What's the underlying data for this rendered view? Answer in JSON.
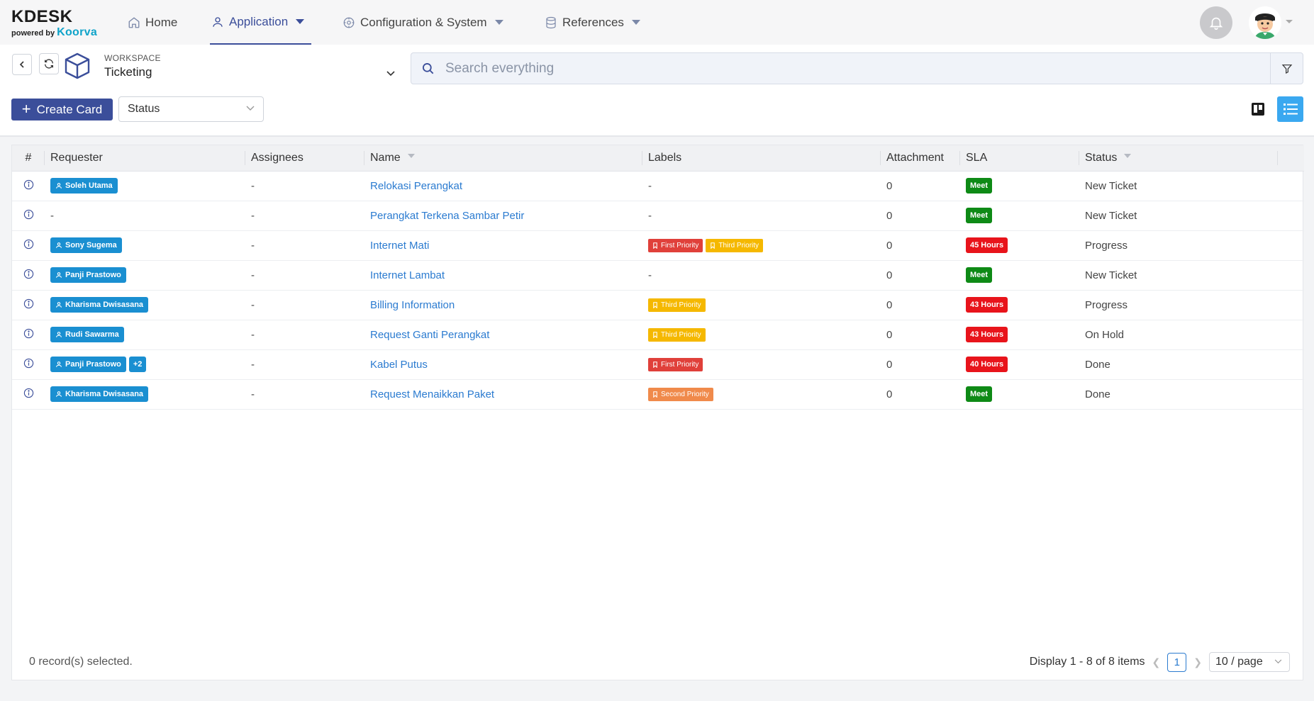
{
  "brand": {
    "name": "KDESK",
    "powered_by": "powered by",
    "partner": "Koorva"
  },
  "nav": {
    "home": "Home",
    "application": "Application",
    "configuration": "Configuration & System",
    "references": "References"
  },
  "workspace": {
    "label": "WORKSPACE",
    "name": "Ticketing"
  },
  "search": {
    "placeholder": "Search everything"
  },
  "toolbar": {
    "create_label": "Create Card",
    "status_filter": "Status"
  },
  "colors": {
    "primary": "#3b4e9a",
    "link": "#2b7bd0",
    "user_tag": "#1a8fd1",
    "sla_meet": "#0e8a16",
    "sla_over": "#e8141b",
    "first_priority": "#e0403a",
    "second_priority": "#f08a4b",
    "third_priority": "#f5b800"
  },
  "table": {
    "columns": [
      "#",
      "Requester",
      "Assignees",
      "Name",
      "Labels",
      "Attachment",
      "SLA",
      "Status"
    ],
    "rows": [
      {
        "requester": "Soleh Utama",
        "more": "",
        "assignees": "-",
        "name": "Relokasi Perangkat",
        "labels": [],
        "attachment": "0",
        "sla": "Meet",
        "sla_type": "meet",
        "status": "New Ticket"
      },
      {
        "requester": "-",
        "more": "",
        "assignees": "-",
        "name": "Perangkat Terkena Sambar Petir",
        "labels": [],
        "attachment": "0",
        "sla": "Meet",
        "sla_type": "meet",
        "status": "New Ticket"
      },
      {
        "requester": "Sony Sugema",
        "more": "",
        "assignees": "-",
        "name": "Internet Mati",
        "labels": [
          {
            "text": "First Priority",
            "type": "first"
          },
          {
            "text": "Third Priority",
            "type": "third"
          }
        ],
        "attachment": "0",
        "sla": "45 Hours",
        "sla_type": "over",
        "status": "Progress"
      },
      {
        "requester": "Panji Prastowo",
        "more": "",
        "assignees": "-",
        "name": "Internet Lambat",
        "labels": [],
        "attachment": "0",
        "sla": "Meet",
        "sla_type": "meet",
        "status": "New Ticket"
      },
      {
        "requester": "Kharisma Dwisasana",
        "more": "",
        "assignees": "-",
        "name": "Billing Information",
        "labels": [
          {
            "text": "Third Priority",
            "type": "third"
          }
        ],
        "attachment": "0",
        "sla": "43 Hours",
        "sla_type": "over",
        "status": "Progress"
      },
      {
        "requester": "Rudi Sawarma",
        "more": "",
        "assignees": "-",
        "name": "Request Ganti Perangkat",
        "labels": [
          {
            "text": "Third Priority",
            "type": "third"
          }
        ],
        "attachment": "0",
        "sla": "43 Hours",
        "sla_type": "over",
        "status": "On Hold"
      },
      {
        "requester": "Panji Prastowo",
        "more": "+2",
        "assignees": "-",
        "name": "Kabel Putus",
        "labels": [
          {
            "text": "First Priority",
            "type": "first"
          }
        ],
        "attachment": "0",
        "sla": "40 Hours",
        "sla_type": "over",
        "status": "Done"
      },
      {
        "requester": "Kharisma Dwisasana",
        "more": "",
        "assignees": "-",
        "name": "Request Menaikkan Paket",
        "labels": [
          {
            "text": "Second Priority",
            "type": "second"
          }
        ],
        "attachment": "0",
        "sla": "Meet",
        "sla_type": "meet",
        "status": "Done"
      }
    ],
    "empty_dash": "-"
  },
  "footer": {
    "selected": "0 record(s) selected.",
    "display": "Display 1 - 8 of 8 items",
    "current_page": "1",
    "page_size": "10 / page"
  }
}
